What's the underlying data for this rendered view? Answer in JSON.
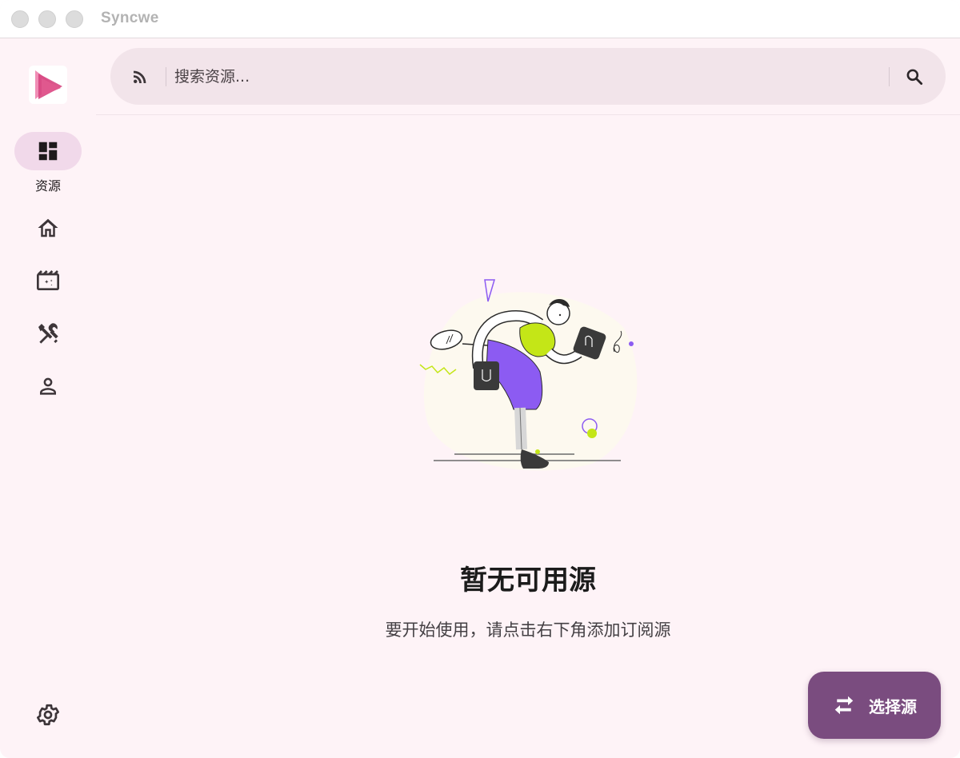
{
  "window": {
    "title": "Syncwe"
  },
  "sidebar": {
    "items": [
      {
        "id": "resources",
        "label": "资源",
        "icon": "dashboard-icon",
        "active": true
      },
      {
        "id": "home",
        "label": "",
        "icon": "home-icon",
        "active": false
      },
      {
        "id": "media",
        "label": "",
        "icon": "movie-icon",
        "active": false
      },
      {
        "id": "tools",
        "label": "",
        "icon": "tools-icon",
        "active": false
      },
      {
        "id": "profile",
        "label": "",
        "icon": "person-icon",
        "active": false
      }
    ],
    "settings_icon": "settings-icon"
  },
  "search": {
    "placeholder": "搜索资源...",
    "value": "",
    "leading_icon": "rss-icon",
    "trailing_icon": "search-icon"
  },
  "empty_state": {
    "title": "暂无可用源",
    "subtitle": "要开始使用，请点击右下角添加订阅源"
  },
  "fab": {
    "label": "选择源",
    "icon": "swap-icon"
  },
  "colors": {
    "background": "#fef3f7",
    "nav_active": "#f1d9ea",
    "search_bar": "#f2e4ea",
    "fab": "#7a4c7f",
    "illustration_purple": "#8c5bf2",
    "illustration_lime": "#c4e617",
    "icon": "#3d3539"
  }
}
